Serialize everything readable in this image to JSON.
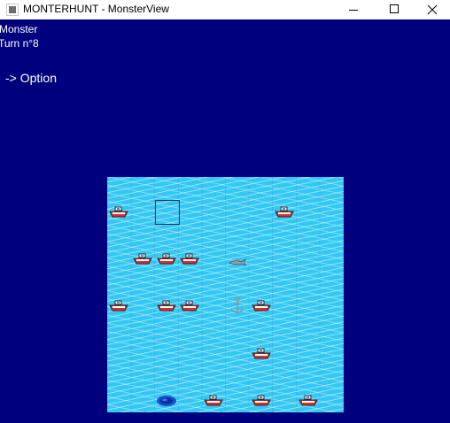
{
  "window": {
    "title": "MONTERHUNT - MonsterView",
    "minimize_icon": "minimize-icon",
    "maximize_icon": "maximize-icon",
    "close_icon": "close-icon"
  },
  "header": {
    "player_label": "Monster",
    "turn_label": "Turn n°8",
    "option_link": "-> Option"
  },
  "board": {
    "grid_size": 10,
    "water_color": "#33c8f3",
    "background_color": "#00007f",
    "selected_cell": {
      "row": 1,
      "col": 2
    },
    "pieces": [
      {
        "type": "boat",
        "row": 1,
        "col": 0
      },
      {
        "type": "boat",
        "row": 1,
        "col": 7
      },
      {
        "type": "boat",
        "row": 3,
        "col": 1
      },
      {
        "type": "boat",
        "row": 3,
        "col": 2
      },
      {
        "type": "boat",
        "row": 3,
        "col": 3
      },
      {
        "type": "shark",
        "row": 3,
        "col": 5
      },
      {
        "type": "boat",
        "row": 5,
        "col": 0
      },
      {
        "type": "boat",
        "row": 5,
        "col": 2
      },
      {
        "type": "boat",
        "row": 5,
        "col": 3
      },
      {
        "type": "anchor",
        "row": 5,
        "col": 5
      },
      {
        "type": "boat",
        "row": 5,
        "col": 6
      },
      {
        "type": "boat",
        "row": 7,
        "col": 6
      },
      {
        "type": "monster",
        "row": 9,
        "col": 2
      },
      {
        "type": "boat",
        "row": 9,
        "col": 4
      },
      {
        "type": "boat",
        "row": 9,
        "col": 6
      },
      {
        "type": "boat",
        "row": 9,
        "col": 8
      }
    ]
  }
}
